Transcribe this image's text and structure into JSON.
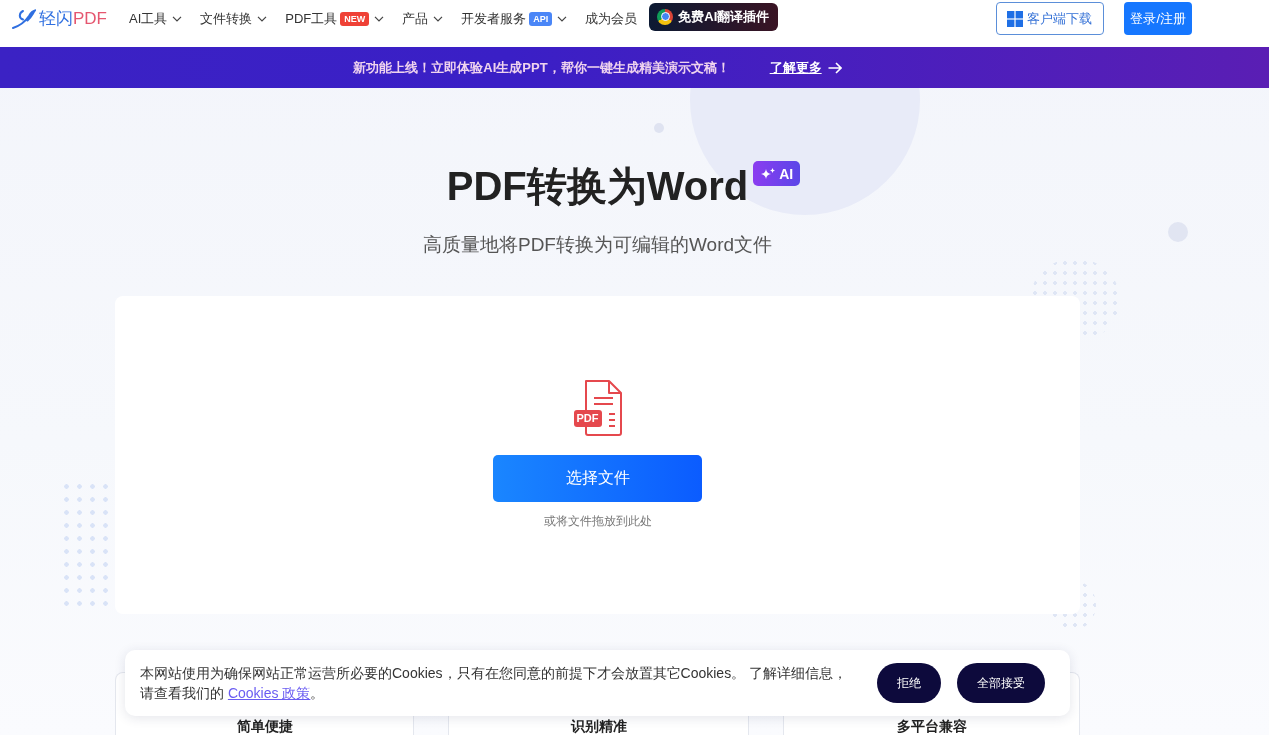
{
  "nav": {
    "logo": {
      "name": "轻闪",
      "suffix": "PDF"
    },
    "items": [
      {
        "label": "AI工具",
        "dropdown": true
      },
      {
        "label": "文件转换",
        "dropdown": true
      },
      {
        "label": "PDF工具",
        "tag": {
          "text": "NEW",
          "color": "#ef4136"
        },
        "dropdown": true
      },
      {
        "label": "产品",
        "dropdown": true
      },
      {
        "label": "开发者服务",
        "tag": {
          "text": "API",
          "color": "#4a86f7"
        },
        "dropdown": true
      },
      {
        "label": "成为会员",
        "dropdown": false
      }
    ],
    "plugin_button": "免费AI翻译插件",
    "download_button": "客户端下载",
    "login_button": "登录/注册"
  },
  "banner": {
    "text": "新功能上线！立即体验AI生成PPT，帮你一键生成精美演示文稿！",
    "link": "了解更多"
  },
  "hero": {
    "title": "PDF转换为Word",
    "badge": "AI",
    "subtitle": "高质量地将PDF转换为可编辑的Word文件"
  },
  "upload": {
    "file_type": "PDF",
    "button": "选择文件",
    "hint": "或将文件拖放到此处"
  },
  "features": [
    {
      "title": "简单便捷"
    },
    {
      "title": "识别精准"
    },
    {
      "title": "多平台兼容"
    }
  ],
  "cookie_notice": {
    "text": "本网站使用为确保网站正常运营所必要的Cookies，只有在您同意的前提下才会放置其它Cookies。 了解详细信息，请查看我们的",
    "link": "Cookies 政策",
    "text_after": "。",
    "buttons": [
      {
        "label": "拒绝"
      },
      {
        "label": "全部接受"
      }
    ]
  }
}
